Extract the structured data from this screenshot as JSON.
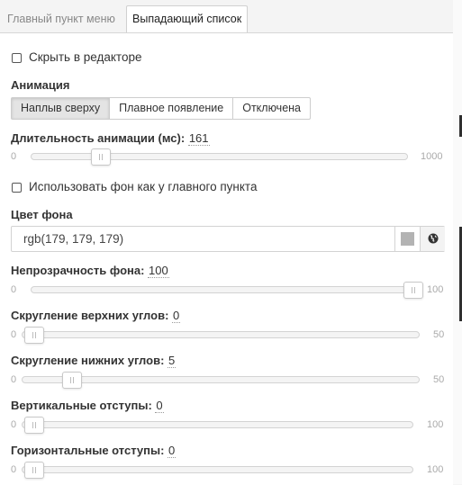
{
  "tabs": [
    {
      "label": "Главный пункт меню",
      "active": false
    },
    {
      "label": "Выпадающий список",
      "active": true
    }
  ],
  "hide_in_editor": {
    "label": "Скрыть в редакторе",
    "checked": false
  },
  "animation": {
    "heading": "Анимация",
    "options": [
      "Наплыв сверху",
      "Плавное появление",
      "Отключена"
    ],
    "selected": "Наплыв сверху"
  },
  "duration": {
    "label": "Длительность анимации (мс)",
    "value": "161",
    "min": "0",
    "max": "1000",
    "current": 161,
    "range": [
      0,
      1000
    ]
  },
  "use_main_bg": {
    "label": "Использовать фон как у главного пункта",
    "checked": false
  },
  "bg_color": {
    "label": "Цвет фона",
    "value": "rgb(179, 179, 179)",
    "swatch": "#b3b3b3",
    "icon": "globe-icon"
  },
  "bg_opacity": {
    "label": "Непрозрачность фона",
    "value": "100",
    "min": "0",
    "max": "100",
    "current": 100,
    "range": [
      0,
      100
    ]
  },
  "top_radius": {
    "label": "Скругление верхних углов",
    "value": "0",
    "min": "0",
    "max": "50",
    "current": 0,
    "range": [
      0,
      50
    ]
  },
  "bottom_radius": {
    "label": "Скругление нижних углов",
    "value": "5",
    "min": "0",
    "max": "50",
    "current": 5,
    "range": [
      0,
      50
    ]
  },
  "vertical_padding": {
    "label": "Вертикальные отступы",
    "value": "0",
    "min": "0",
    "max": "100",
    "current": 0,
    "range": [
      0,
      100
    ]
  },
  "horizontal_padding": {
    "label": "Горизонтальные отступы",
    "value": "0",
    "min": "0",
    "max": "100",
    "current": 0,
    "range": [
      0,
      100
    ]
  }
}
